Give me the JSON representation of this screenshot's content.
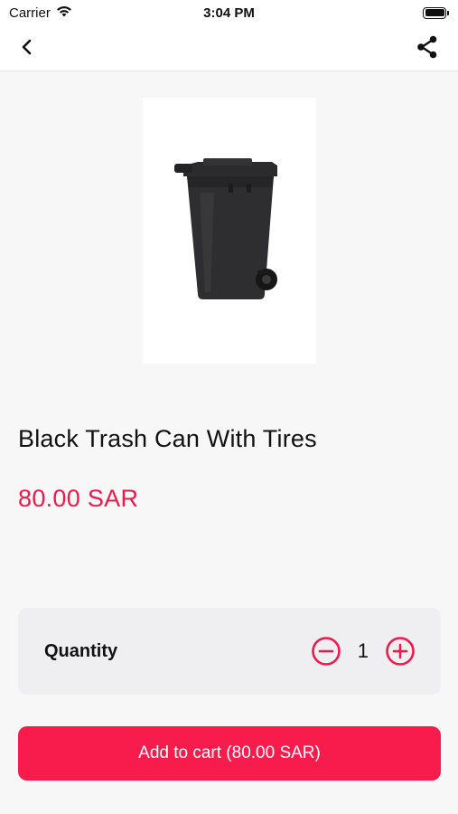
{
  "status_bar": {
    "carrier": "Carrier",
    "time": "3:04 PM",
    "icons": [
      "wifi-icon",
      "battery-icon"
    ]
  },
  "nav": {
    "back_icon": "chevron-left-icon",
    "share_icon": "share-icon"
  },
  "product": {
    "image_icon": "trash-can-image",
    "title": "Black Trash Can With Tires",
    "price": "80.00 SAR"
  },
  "quantity": {
    "label": "Quantity",
    "value": "1",
    "decrement_icon": "minus-circle-icon",
    "increment_icon": "plus-circle-icon"
  },
  "cart": {
    "button_label": "Add to cart (80.00 SAR)"
  },
  "colors": {
    "accent": "#f81c4d",
    "price": "#f0184a",
    "background": "#f7f7f8",
    "card": "#efeff2"
  }
}
